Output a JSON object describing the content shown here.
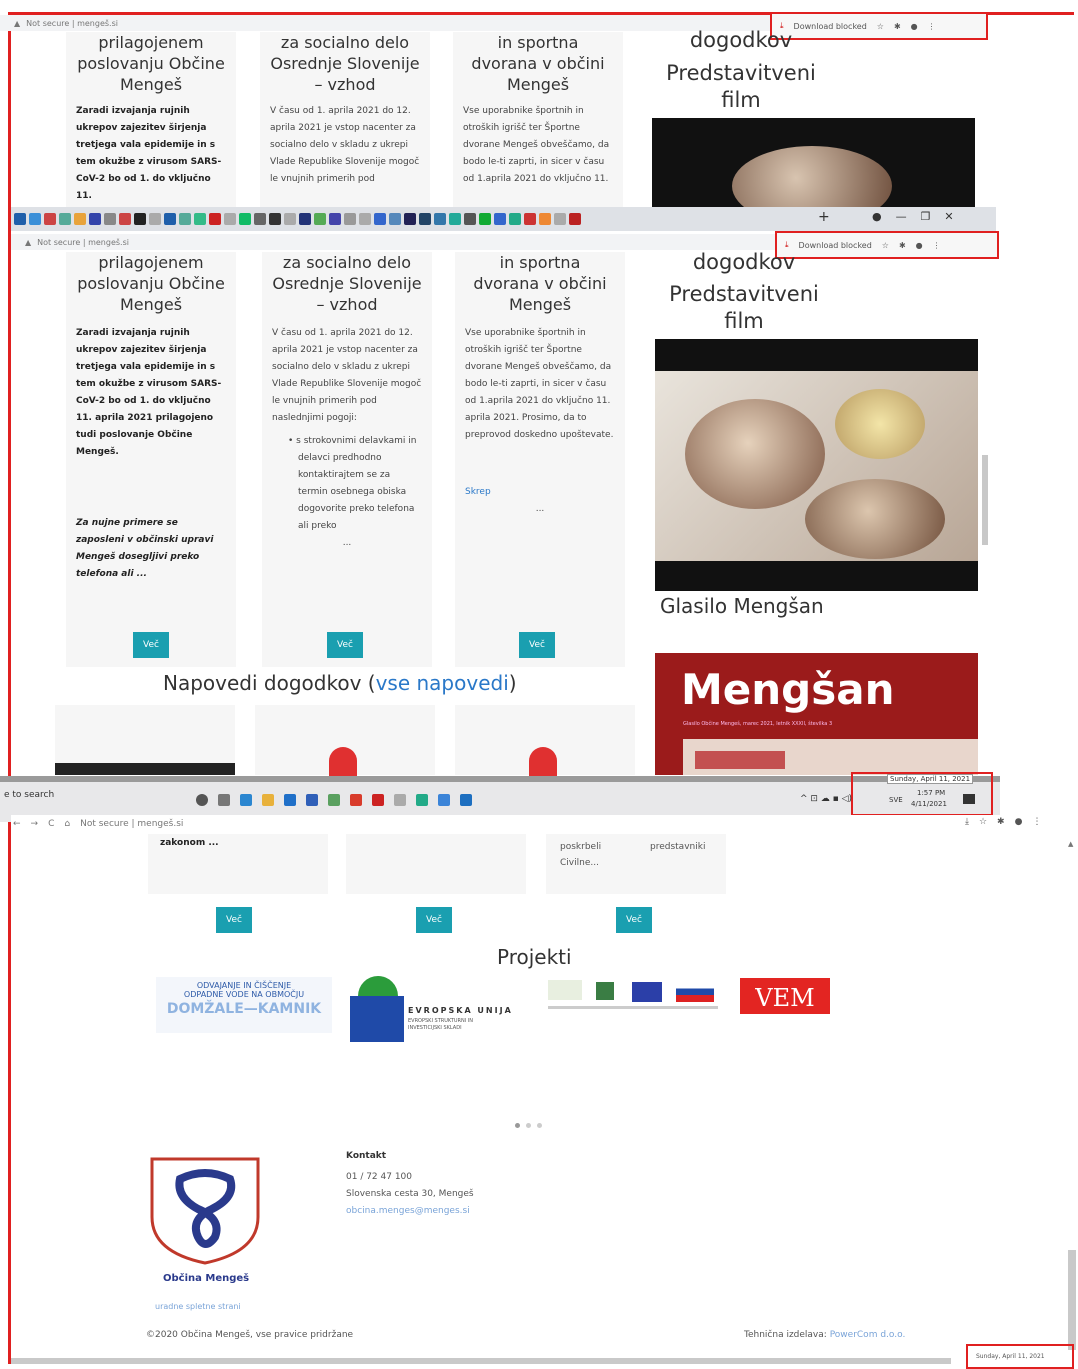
{
  "browser": {
    "address_label": "Not secure | mengeš.si",
    "download_blocked": "Download blocked",
    "new_tab": "+"
  },
  "cards": [
    {
      "title_lines": [
        "prilagojenem",
        "poslovanju Občine",
        "Mengeš"
      ],
      "text_top": "Zaradi izvajanja rujnih ukrepov zajezitev širjenja tretjega vala epidemije in s tem okužbe z virusom SARS-CoV-2 bo od 1. do vključno 11.",
      "text_top_cut": "aprila 2021 prilagojeno",
      "text_full": "Zaradi izvajanja rujnih ukrepov zajezitev širjenja tretjega vala epidemije in s tem okužbe z virusom SARS-CoV-2 bo od 1. do vključno 11. aprila 2021 prilagojeno tudi poslovanje Občine Mengeš.",
      "text_italic": "Za nujne primere se zaposleni v občinski upravi Mengeš dosegljivi preko telefona ali ..."
    },
    {
      "title_lines": [
        "za socialno delo",
        "Osrednje Slovenije",
        "– vzhod"
      ],
      "text_top": "V času od 1. aprila 2021 do 12. aprila 2021 je vstop nacenter za socialno delo v skladu z ukrepi Vlade Republike Slovenije mogoč le vnujnih primerih pod",
      "text_top_cut": "naslednjimi pogoji:",
      "text_full": "V času od 1. aprila 2021 do 12. aprila 2021 je vstop nacenter za socialno delo v skladu z ukrepi Vlade Republike Slovenije mogoč le vnujnih primerih pod naslednjimi pogoji:",
      "bullet": "s strokovnimi delavkami in delavci predhodno kontaktirajtem se za termin osebnega obiska dogovorite preko telefona ali preko",
      "ellipsis": "..."
    },
    {
      "title_lines": [
        "in sportna",
        "dvorana v občini",
        "Mengeš"
      ],
      "text_top": "Vse uporabnike športnih in otroških igrišč ter Športne dvorane Mengeš obveščamo, da bodo le-ti zaprti, in sicer v času od 1.aprila 2021 do vključno 11.",
      "text_top_cut": "aprila 2021. Prosimo, da to",
      "text_full": "Vse uporabnike športnih in otroških igrišč ter Športne dvorane Mengeš obveščamo, da bodo le-ti zaprti, in sicer v času od 1.aprila 2021 do vključno 11. aprila 2021. Prosimo, da to preprovod doskedno upoštevate.",
      "link": "Skrep",
      "ellipsis": "..."
    }
  ],
  "more_button": "Več",
  "sidebar": {
    "events_head": "dogodkov",
    "film_title_1": "Predstavitveni",
    "film_title_2": "film",
    "glasilo": "Glasilo Mengšan",
    "mengsan": "Mengšan",
    "mengsan_sub": "Glasilo Občine Mengeš, marec 2021, letnik XXXII, številka 3"
  },
  "napovedi": {
    "title": "Napovedi dogodkov",
    "link": "vse napovedi"
  },
  "taskbar": {
    "search": "e to search",
    "time": "1:57 PM",
    "date": "4/11/2021",
    "tooltip": "Sunday, April 11, 2021",
    "lang": "SVE"
  },
  "bottom_cards": {
    "left_text": "zakonom ...",
    "right_text_1": "poskrbeli",
    "right_text_2": "predstavniki",
    "right_text_3": "Civilne..."
  },
  "projekti": {
    "title": "Projekti",
    "logo1_line1": "ODVAJANJE IN ČIŠČENJE",
    "logo1_line2": "ODPADNE VODE NA OBMOČJU",
    "logo1_line3": "DOMŽALE—KAMNIK",
    "eu_line1": "EVROPSKA UNIJA",
    "eu_line2": "EVROPSKI STRUKTURNI IN",
    "eu_line3": "INVESTICIJSKI SKLADI",
    "vem": "VEM"
  },
  "footer": {
    "kontakt_head": "Kontakt",
    "phone": "01 / 72 47 100",
    "address": "Slovenska cesta 30, Mengeš",
    "email": "obcina.menges@menges.si",
    "obcina": "Občina Mengeš",
    "crest_sub": "uradne spletne strani",
    "copyright": "©2020 Občina Mengeš, vse pravice pridržane",
    "tech": "Tehnična izdelava:",
    "tech_link": "PowerCom d.o.o."
  },
  "corner_tooltip": "Sunday, April 11, 2021",
  "colors": {
    "highlight_red": "#e02020",
    "teal": "#1a9fb0",
    "mengsan_red": "#9b1b1b",
    "link_blue": "#2a78c8"
  }
}
